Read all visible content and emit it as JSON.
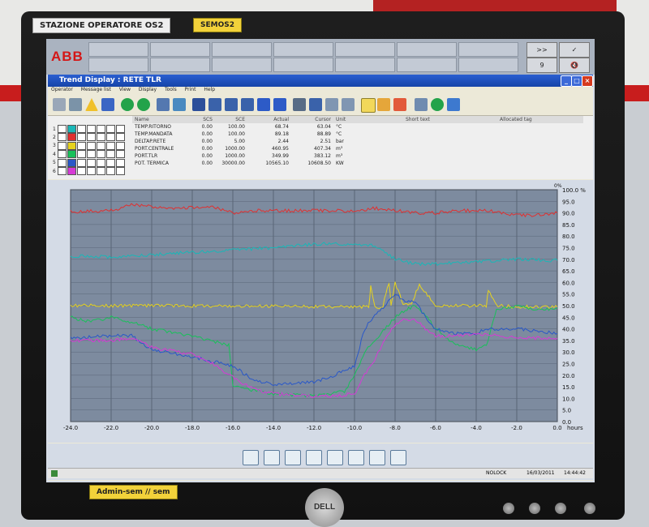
{
  "room": {
    "station_label": "STAZIONE OPERATORE OS2",
    "semos_label": "SEMOS2",
    "admin_label": "Admin-sem // sem",
    "monitor_brand": "DELL"
  },
  "banner": {
    "logo": "ABB",
    "right_top": ">>",
    "right_bottom": "9"
  },
  "window": {
    "title": "Trend Display : RETE TLR",
    "menu": [
      "Operator",
      "Message list",
      "View",
      "Display",
      "Tools",
      "Print",
      "Help"
    ]
  },
  "table": {
    "headers": [
      "Name",
      "SCS",
      "SCE",
      "Actual",
      "Cursor",
      "Unit",
      "Short text",
      "Allocated tag"
    ],
    "rows": [
      {
        "idx": "1",
        "name": "TEMP.RITORNO",
        "scs": "0.00",
        "sce": "100.00",
        "actual": "68.74",
        "cursor": "63.04",
        "unit": "°C",
        "color": "#19b7b7"
      },
      {
        "idx": "2",
        "name": "TEMP.MANDATA",
        "scs": "0.00",
        "sce": "100.00",
        "actual": "89.18",
        "cursor": "88.89",
        "unit": "°C",
        "color": "#e03030"
      },
      {
        "idx": "3",
        "name": "DELTAP.RETE",
        "scs": "0.00",
        "sce": "5.00",
        "actual": "2.44",
        "cursor": "2.51",
        "unit": "bar",
        "color": "#e6d21f"
      },
      {
        "idx": "4",
        "name": "PORT.CENTRALE",
        "scs": "0.00",
        "sce": "1000.00",
        "actual": "460.95",
        "cursor": "407.34",
        "unit": "m³",
        "color": "#19c05a"
      },
      {
        "idx": "5",
        "name": "PORT.TLR",
        "scs": "0.00",
        "sce": "1000.00",
        "actual": "349.99",
        "cursor": "383.12",
        "unit": "m³",
        "color": "#2a58c8"
      },
      {
        "idx": "6",
        "name": "POT. TERMICA",
        "scs": "0.00",
        "sce": "30000.00",
        "actual": "10565.10",
        "cursor": "10608.50",
        "unit": "KW",
        "color": "#d63ad6"
      }
    ]
  },
  "chart_data": {
    "type": "line",
    "xlabel": "hours",
    "x_ticks": [
      "-24.0",
      "-22.0",
      "-20.0",
      "-18.0",
      "-16.0",
      "-14.0",
      "-12.0",
      "-10.0",
      "-8.0",
      "-6.0",
      "-4.0",
      "-2.0",
      "0.0"
    ],
    "y_ticks": [
      "100.0 %",
      "95.0",
      "90.0",
      "85.0",
      "80.0",
      "75.0",
      "70.0",
      "65.0",
      "60.0",
      "55.0",
      "50.0",
      "45.0",
      "40.0",
      "35.0",
      "30.0",
      "25.0",
      "20.0",
      "15.0",
      "10.0",
      "5.0",
      "0.0"
    ],
    "xlim": [
      -24,
      0
    ],
    "ylim": [
      0,
      100
    ],
    "zoom_label": "0%",
    "grid": true,
    "series": [
      {
        "color": "#e03030",
        "x": [
          -24,
          -22,
          -21,
          -19,
          -17,
          -16,
          -15,
          -13,
          -11,
          -10,
          -9,
          -7,
          -6,
          -5,
          -3.5,
          -2,
          -1,
          0
        ],
        "values": [
          90.5,
          91,
          93.5,
          92,
          92.5,
          90,
          91,
          91,
          91,
          90.5,
          92,
          90,
          90,
          91,
          91,
          89,
          89,
          90
        ]
      },
      {
        "color": "#19b7b7",
        "x": [
          -24,
          -22,
          -20,
          -18,
          -16,
          -14,
          -12,
          -11,
          -10,
          -9,
          -8.5,
          -8,
          -7,
          -6,
          -4,
          -2,
          0
        ],
        "values": [
          71.5,
          71,
          72,
          73,
          74,
          75,
          76.5,
          77,
          76,
          76,
          73,
          70,
          68,
          68,
          69,
          70,
          69.5
        ]
      },
      {
        "color": "#e6d21f",
        "x": [
          -24,
          -20,
          -16,
          -12,
          -10,
          -9.3,
          -9.2,
          -9,
          -8.8,
          -8.6,
          -8.3,
          -8.2,
          -8,
          -7.6,
          -7.2,
          -6.8,
          -6,
          -4,
          -3.5,
          -3.4,
          -3,
          -2,
          0
        ],
        "values": [
          50,
          50,
          49.8,
          49.6,
          49.5,
          49.5,
          58,
          49.5,
          49,
          50,
          60,
          50.5,
          60,
          50.5,
          51,
          59,
          50,
          50,
          50,
          57,
          50,
          49.5,
          49.5
        ]
      },
      {
        "color": "#19c05a",
        "x": [
          -24,
          -23,
          -22,
          -21.6,
          -21,
          -20,
          -18,
          -16.2,
          -16,
          -14,
          -12,
          -10.5,
          -10,
          -9.5,
          -9,
          -8.5,
          -8,
          -7.5,
          -7,
          -6.5,
          -6,
          -5,
          -4,
          -3.5,
          -3,
          -2,
          -1,
          0
        ],
        "values": [
          45,
          43,
          45,
          44,
          43,
          40,
          37,
          33,
          15,
          12,
          11,
          13,
          20,
          30,
          35,
          40,
          45,
          48,
          50,
          46,
          40,
          33,
          31,
          33,
          48,
          50,
          48,
          49
        ]
      },
      {
        "color": "#2a58c8",
        "x": [
          -24,
          -22,
          -21,
          -20,
          -18,
          -16,
          -15,
          -14,
          -12,
          -11,
          -10,
          -9.5,
          -9,
          -8.5,
          -8,
          -7.5,
          -7,
          -6.5,
          -6,
          -5,
          -4,
          -3.5,
          -3,
          -2,
          -1,
          0
        ],
        "values": [
          36,
          37,
          37,
          31,
          28,
          24,
          18,
          16,
          17,
          20,
          24,
          40,
          46,
          50,
          55,
          52,
          52,
          45,
          40,
          38,
          38,
          40,
          40,
          40,
          39,
          38
        ]
      },
      {
        "color": "#d63ad6",
        "x": [
          -24,
          -22,
          -21,
          -20,
          -18,
          -17,
          -16,
          -15,
          -14,
          -12,
          -11,
          -10,
          -9.5,
          -9,
          -8.5,
          -8,
          -7.5,
          -7,
          -6.5,
          -6,
          -5,
          -4,
          -3,
          -2,
          -1,
          0
        ],
        "values": [
          35,
          35,
          36,
          32,
          29,
          25,
          19,
          14,
          12,
          11,
          11,
          12,
          20,
          27,
          35,
          42,
          44,
          44,
          40,
          37,
          37,
          38,
          37,
          36,
          36,
          36
        ]
      }
    ]
  },
  "status": {
    "nolock": "NOLOCK",
    "date": "16/03/2011",
    "time": "14:44:42"
  }
}
